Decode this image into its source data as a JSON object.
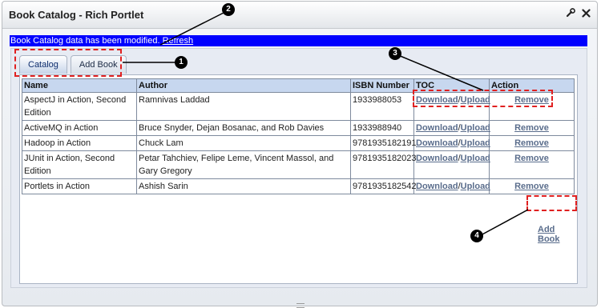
{
  "portlet": {
    "title": "Book Catalog - Rich Portlet",
    "tools": [
      "wrench-icon",
      "close-icon"
    ]
  },
  "notice": {
    "message": "Book Catalog data has been modified.",
    "link": "Refresh"
  },
  "tabs": [
    {
      "label": "Catalog",
      "active": true
    },
    {
      "label": "Add Book",
      "active": false
    }
  ],
  "table": {
    "headers": {
      "name": "Name",
      "author": "Author",
      "isbn": "ISBN Number",
      "toc": "TOC",
      "action": "Action"
    },
    "toc_links": {
      "download": "Download",
      "separator": "/",
      "upload": "Upload"
    },
    "action_label": "Remove",
    "rows": [
      {
        "name": "AspectJ in Action, Second Edition",
        "author": "Ramnivas Laddad",
        "isbn": "1933988053"
      },
      {
        "name": "ActiveMQ in Action",
        "author": "Bruce Snyder, Dejan Bosanac, and Rob Davies",
        "isbn": "1933988940"
      },
      {
        "name": "Hadoop in Action",
        "author": "Chuck Lam",
        "isbn": "9781935182191"
      },
      {
        "name": "JUnit in Action, Second Edition",
        "author": "Petar Tahchiev, Felipe Leme, Vincent Massol, and Gary Gregory",
        "isbn": "9781935182023"
      },
      {
        "name": "Portlets in Action",
        "author": "Ashish Sarin",
        "isbn": "9781935182542"
      }
    ]
  },
  "add_book_link": "Add Book",
  "callouts": {
    "c1": "1",
    "c2": "2",
    "c3": "3",
    "c4": "4"
  },
  "colors": {
    "notice_bg": "#0000ff",
    "annotation": "#e02020",
    "header_bg": "#c7d7ef"
  }
}
